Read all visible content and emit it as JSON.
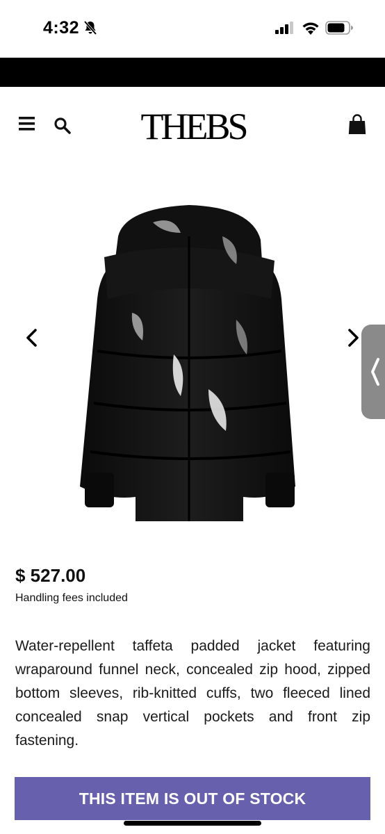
{
  "status_bar": {
    "time": "4:32",
    "icons": [
      "bell-slash-icon",
      "cellular-signal-icon",
      "wifi-icon",
      "battery-icon"
    ]
  },
  "header": {
    "brand": "THEBS",
    "icons": [
      "hamburger-menu-icon",
      "search-icon",
      "shopping-bag-icon"
    ]
  },
  "gallery": {
    "prev_icon": "chevron-left-icon",
    "next_icon": "chevron-right-icon",
    "side_tab_icon": "chevron-left-icon",
    "image": "black-glossy-puffer-jacket"
  },
  "product": {
    "price": "$ 527.00",
    "fees_note": "Handling fees included",
    "description": "Water-repellent taffeta padded jacket featuring wraparound funnel neck, concealed zip hood, zipped bottom sleeves, rib-knitted cuffs, two fleeced lined concealed snap vertical pockets and front zip fastening."
  },
  "cta": {
    "label": "THIS ITEM IS OUT OF STOCK",
    "color": "#6761ad"
  }
}
